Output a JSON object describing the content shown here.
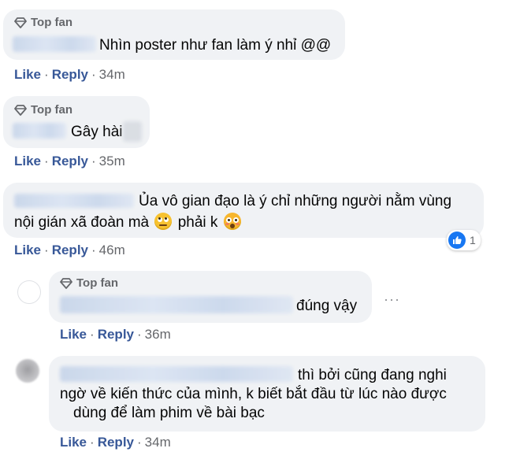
{
  "badge_label": "Top fan",
  "comments": [
    {
      "text": "Nhìn poster như fan làm ý nhỉ @@",
      "like": "Like",
      "reply": "Reply",
      "time": "34m"
    },
    {
      "text": "Gây hài",
      "like": "Like",
      "reply": "Reply",
      "time": "35m"
    },
    {
      "text_line1": "Ủa vô gian đạo là ý chỉ những người nằm vùng",
      "text_line2a": "nội gián xã đoàn mà",
      "text_line2b": "phải k",
      "emoji1": "face-with-rolling-eyes-icon",
      "emoji2": "flushed-face-icon",
      "like": "Like",
      "reply": "Reply",
      "time": "46m",
      "reaction_count": "1"
    }
  ],
  "replies": [
    {
      "text": "đúng vậy",
      "like": "Like",
      "reply": "Reply",
      "time": "36m"
    },
    {
      "text_line1": "thì bởi cũng đang nghi",
      "text_line2": "ngờ về kiến thức của mình, k biết bắt đầu từ lúc nào được",
      "text_line3": "dùng để làm phim về bài bạc",
      "like": "Like",
      "reply": "Reply",
      "time": "34m"
    }
  ],
  "colors": {
    "link": "#385898",
    "muted": "#65676b",
    "bubble": "#f0f2f5",
    "like_blue": "#1877f2"
  }
}
